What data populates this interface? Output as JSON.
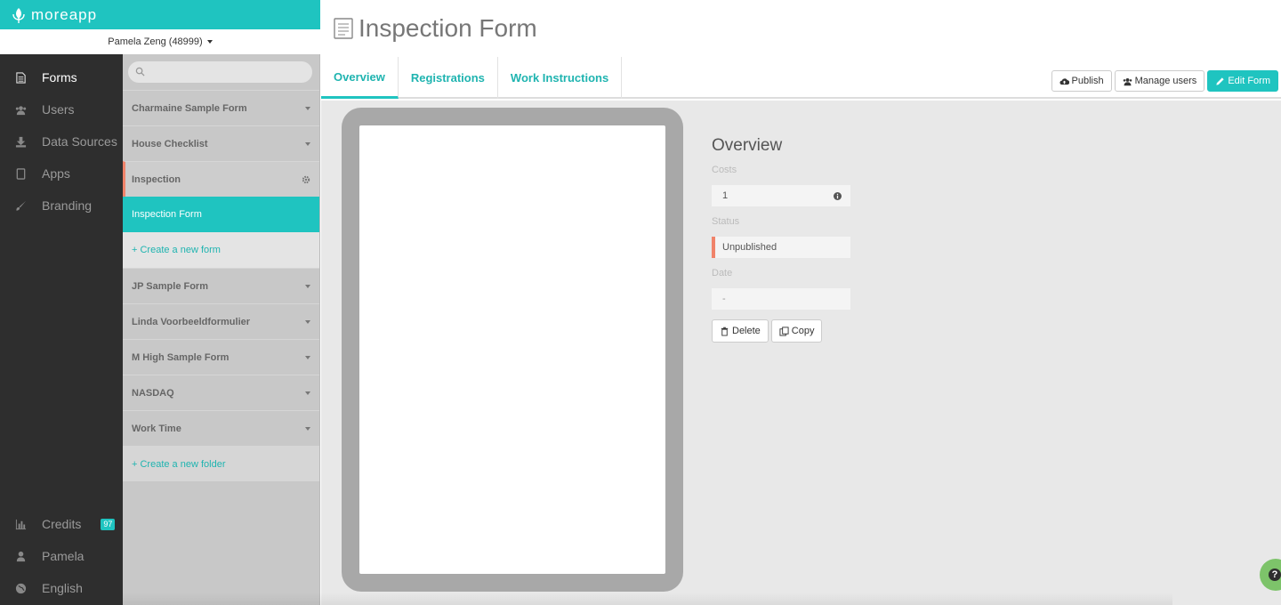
{
  "brand": {
    "name": "moreapp"
  },
  "account": {
    "label": "Pamela Zeng (48999)"
  },
  "nav": {
    "items": [
      {
        "label": "Forms",
        "icon": "document-icon"
      },
      {
        "label": "Users",
        "icon": "users-icon"
      },
      {
        "label": "Data Sources",
        "icon": "download-icon"
      },
      {
        "label": "Apps",
        "icon": "tablet-icon"
      },
      {
        "label": "Branding",
        "icon": "brush-icon"
      }
    ],
    "bottom": [
      {
        "label": "Credits",
        "icon": "bar-chart-icon",
        "badge": "97"
      },
      {
        "label": "Pamela",
        "icon": "user-icon"
      },
      {
        "label": "English",
        "icon": "globe-icon"
      }
    ]
  },
  "folders": {
    "search_placeholder": "",
    "list": [
      {
        "label": "Charmaine Sample Form"
      },
      {
        "label": "House Checklist"
      },
      {
        "label": "Inspection"
      }
    ],
    "active_form": "Inspection Form",
    "create_form": "+ Create a new form",
    "list2": [
      {
        "label": "JP Sample Form"
      },
      {
        "label": "Linda Voorbeeldformulier"
      },
      {
        "label": "M High Sample Form"
      },
      {
        "label": "NASDAQ"
      },
      {
        "label": "Work Time"
      }
    ],
    "create_folder": "+ Create a new folder"
  },
  "page": {
    "title": "Inspection Form",
    "tabs": [
      {
        "label": "Overview"
      },
      {
        "label": "Registrations"
      },
      {
        "label": "Work Instructions"
      }
    ],
    "toolbar": {
      "publish": "Publish",
      "manage_users": "Manage users",
      "edit_form": "Edit Form"
    }
  },
  "overview": {
    "heading": "Overview",
    "costs_label": "Costs",
    "costs_value": "1",
    "status_label": "Status",
    "status_value": "Unpublished",
    "date_label": "Date",
    "date_value": "-",
    "delete": "Delete",
    "copy": "Copy"
  },
  "colors": {
    "accent": "#1fc4c0",
    "status": "#f0836a",
    "nav_bg": "#2e2e2e"
  }
}
